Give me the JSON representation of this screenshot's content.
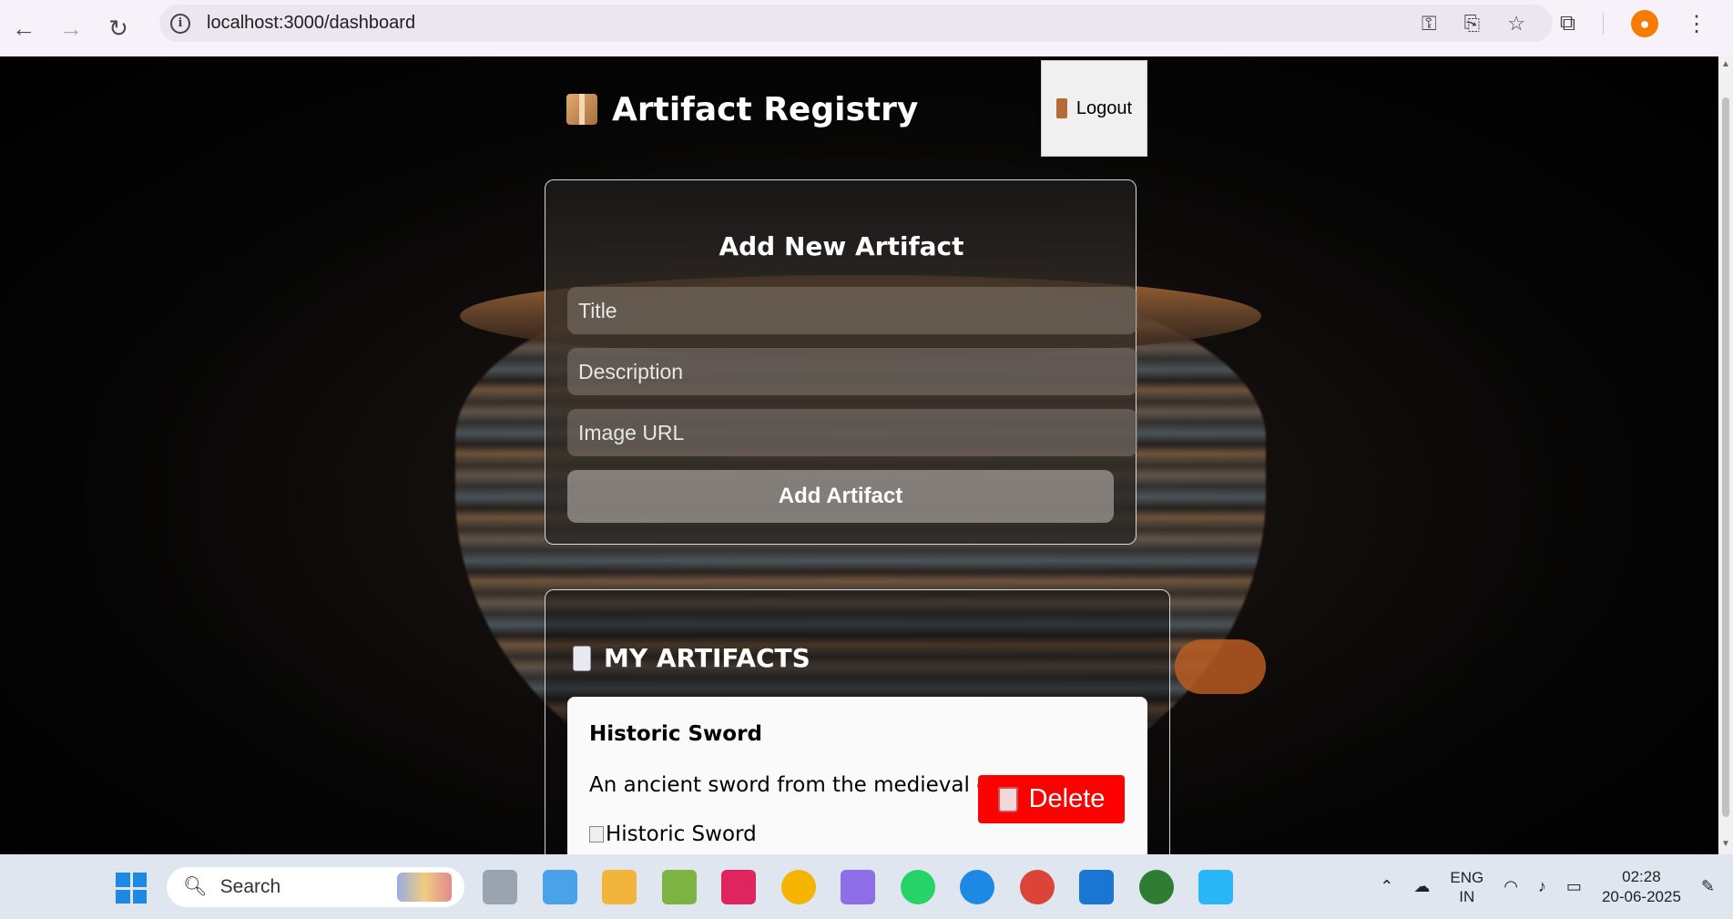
{
  "browser": {
    "url": "localhost:3000/dashboard"
  },
  "header": {
    "title": "Artifact Registry",
    "logout_label": "Logout"
  },
  "form": {
    "title": "Add New Artifact",
    "title_placeholder": "Title",
    "description_placeholder": "Description",
    "image_url_placeholder": "Image URL",
    "submit_label": "Add Artifact"
  },
  "artifacts": {
    "heading": "MY ARTIFACTS",
    "items": [
      {
        "title": "Historic Sword",
        "description": "An ancient sword from the medieval era.",
        "image_alt": "Historic Sword",
        "delete_label": "Delete"
      }
    ]
  },
  "taskbar": {
    "search_placeholder": "Search",
    "lang_top": "ENG",
    "lang_bottom": "IN",
    "time": "02:28",
    "date": "20-06-2025"
  },
  "colors": {
    "delete": "#ff0000",
    "chrome_bg": "#f7f1f9",
    "taskbar_bg": "#dfe6f0"
  }
}
